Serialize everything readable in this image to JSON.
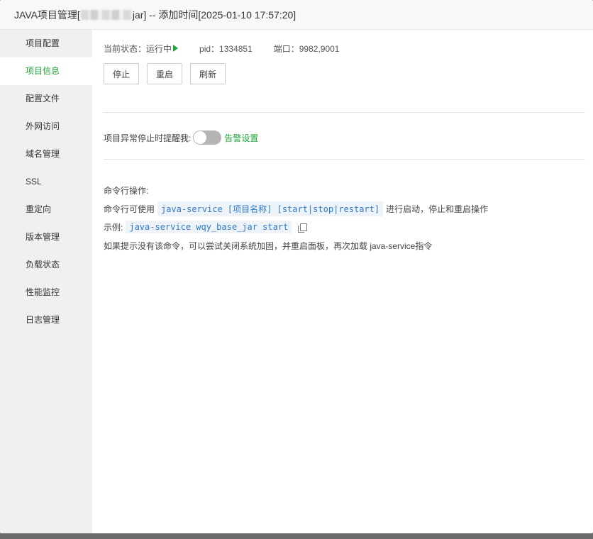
{
  "window": {
    "title_prefix": "JAVA项目管理[",
    "title_suffix": "jar] -- 添加时间[2025-01-10 17:57:20]"
  },
  "sidebar": {
    "items": [
      {
        "label": "项目配置",
        "active": false
      },
      {
        "label": "项目信息",
        "active": true
      },
      {
        "label": "配置文件",
        "active": false
      },
      {
        "label": "外网访问",
        "active": false
      },
      {
        "label": "域名管理",
        "active": false
      },
      {
        "label": "SSL",
        "active": false
      },
      {
        "label": "重定向",
        "active": false
      },
      {
        "label": "版本管理",
        "active": false
      },
      {
        "label": "负载状态",
        "active": false
      },
      {
        "label": "性能监控",
        "active": false
      },
      {
        "label": "日志管理",
        "active": false
      }
    ]
  },
  "status": {
    "state_label": "当前状态：运行中",
    "pid_label": "pid：1334851",
    "port_label": "端口：9982,9001"
  },
  "buttons": {
    "stop": "停止",
    "restart": "重启",
    "refresh": "刷新"
  },
  "alert": {
    "label": "项目异常停止时提醒我:",
    "toggle_on": false,
    "link": "告警设置"
  },
  "command": {
    "heading": "命令行操作:",
    "usage_prefix": "命令行可使用",
    "usage_code": "java-service [项目名称] [start|stop|restart]",
    "usage_suffix": "进行启动，停止和重启操作",
    "example_label": "示例:",
    "example_code": "java-service wqy_base_jar start",
    "hint": "如果提示没有该命令，可以尝试关闭系统加固，并重启面板，再次加载 java-service指令"
  },
  "colors": {
    "accent": "#20a53a",
    "code_text": "#2b7bce",
    "code_bg": "#eef3f7",
    "sidebar_bg": "#f0f0f0"
  }
}
